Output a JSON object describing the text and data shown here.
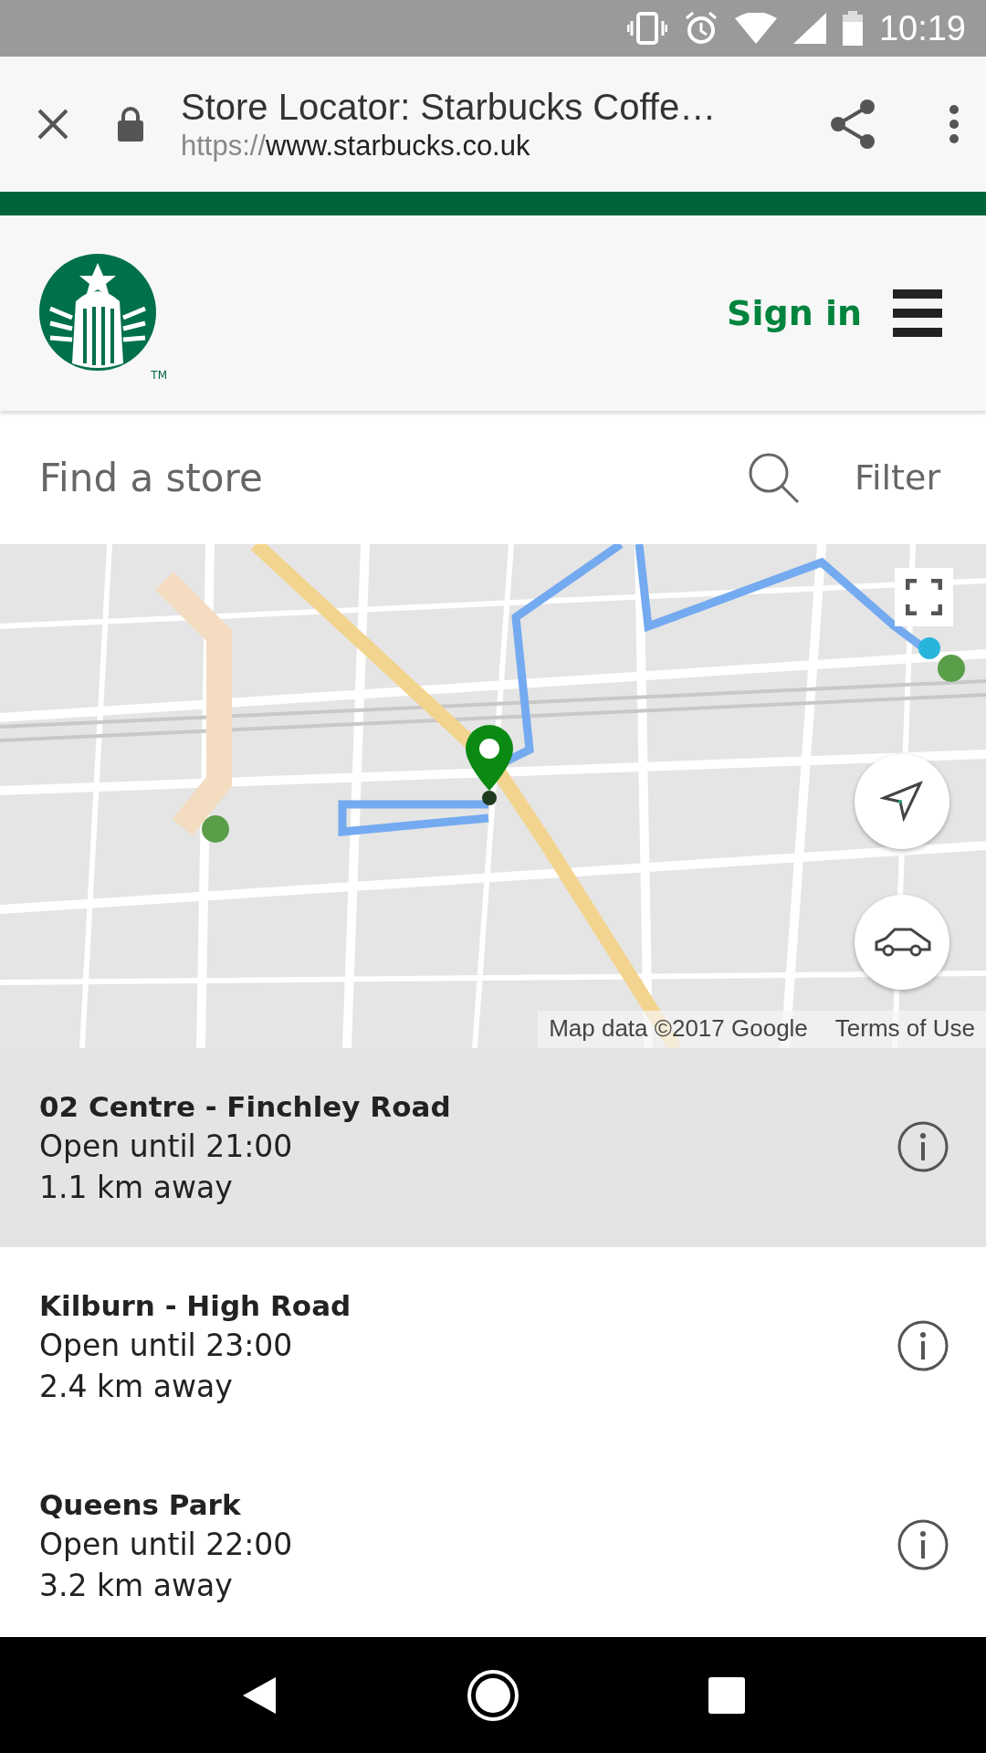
{
  "status_bar": {
    "time": "10:19"
  },
  "browser": {
    "title": "Store Locator: Starbucks Coffe…",
    "url_scheme": "https://",
    "url_host": "www.starbucks.co.uk"
  },
  "header": {
    "trademark": "TM",
    "sign_in": "Sign in"
  },
  "search": {
    "placeholder": "Find a store",
    "filter": "Filter"
  },
  "map": {
    "kind": "picture",
    "attribution": "Map data ©2017 Google",
    "terms": "Terms of Use"
  },
  "stores": [
    {
      "name": "02 Centre - Finchley Road",
      "hours": "Open until 21:00",
      "distance": "1.1 km away",
      "selected": true
    },
    {
      "name": "Kilburn - High Road",
      "hours": "Open until 23:00",
      "distance": "2.4 km away",
      "selected": false
    },
    {
      "name": "Queens Park",
      "hours": "Open until 22:00",
      "distance": "3.2 km away",
      "selected": false
    }
  ]
}
